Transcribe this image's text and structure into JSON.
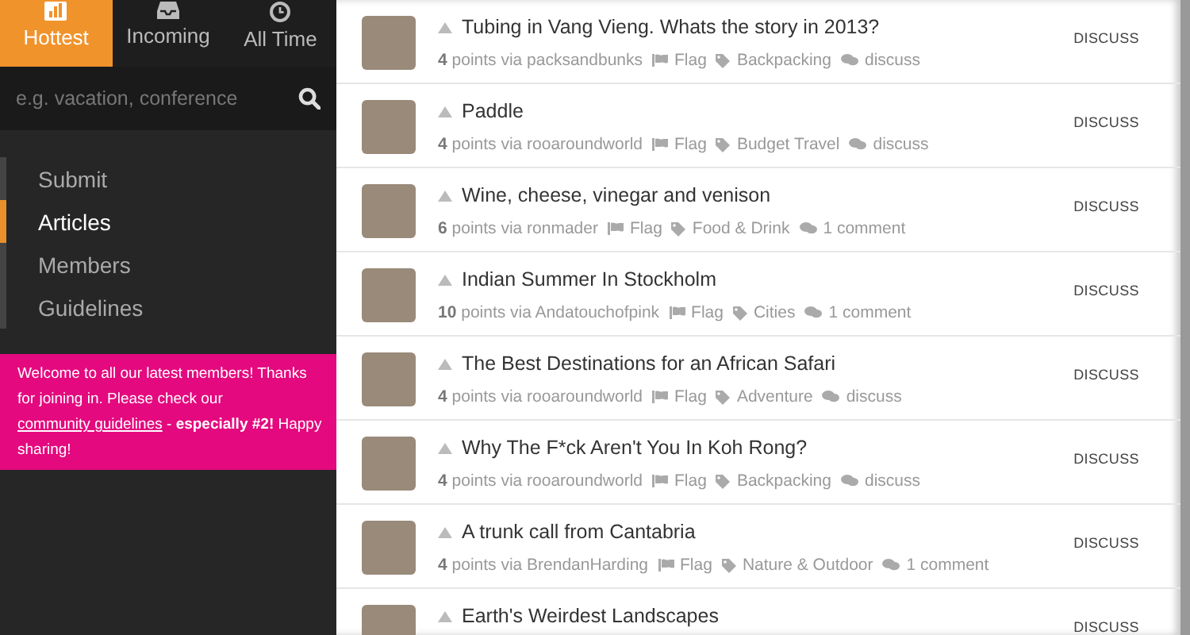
{
  "tabs": [
    {
      "label": "Hottest",
      "kind": "chart",
      "selected": true
    },
    {
      "label": "Incoming",
      "kind": "inbox",
      "selected": false
    },
    {
      "label": "All Time",
      "kind": "clock",
      "selected": false
    }
  ],
  "search": {
    "placeholder": "e.g. vacation, conference"
  },
  "nav": [
    {
      "label": "Submit",
      "selected": false
    },
    {
      "label": "Articles",
      "selected": true
    },
    {
      "label": "Members",
      "selected": false
    },
    {
      "label": "Guidelines",
      "selected": false
    }
  ],
  "notice": {
    "before": "Welcome to all our latest members! Thanks for joining in. Please check our ",
    "link": "community guidelines",
    "after": " - **especially #2!** Happy sharing!"
  },
  "posts": [
    {
      "title": "Tubing in Vang Vieng. Whats the story in 2013?",
      "meta": "**4** points via packsandbunks",
      "flag": "Flag",
      "tag": "Backpacking",
      "comments": "discuss",
      "action": "DISCUSS"
    },
    {
      "title": "Paddle",
      "meta": "**4** points via rooaroundworld",
      "flag": "Flag",
      "tag": "Budget Travel",
      "comments": "discuss",
      "action": "DISCUSS"
    },
    {
      "title": "Wine, cheese, vinegar and venison",
      "meta": "**6** points via ronmader",
      "flag": "Flag",
      "tag": "Food & Drink",
      "comments": "1 comment",
      "action": "DISCUSS"
    },
    {
      "title": "Indian Summer In Stockholm",
      "meta": "**10** points via Andatouchofpink",
      "flag": "Flag",
      "tag": "Cities",
      "comments": "1 comment",
      "action": "DISCUSS"
    },
    {
      "title": "The Best Destinations for an African Safari",
      "meta": "**4** points via rooaroundworld",
      "flag": "Flag",
      "tag": "Adventure",
      "comments": "discuss",
      "action": "DISCUSS"
    },
    {
      "title": "Why The F*ck Aren't You In Koh Rong?",
      "meta": "**4** points via rooaroundworld",
      "flag": "Flag",
      "tag": "Backpacking",
      "comments": "discuss",
      "action": "DISCUSS"
    },
    {
      "title": "A trunk call from Cantabria",
      "meta": "**4** points via BrendanHarding",
      "flag": "Flag",
      "tag": "Nature & Outdoor",
      "comments": "1 comment",
      "action": "DISCUSS"
    },
    {
      "title": "Earth's Weirdest Landscapes",
      "action": "DISCUSS"
    }
  ]
}
